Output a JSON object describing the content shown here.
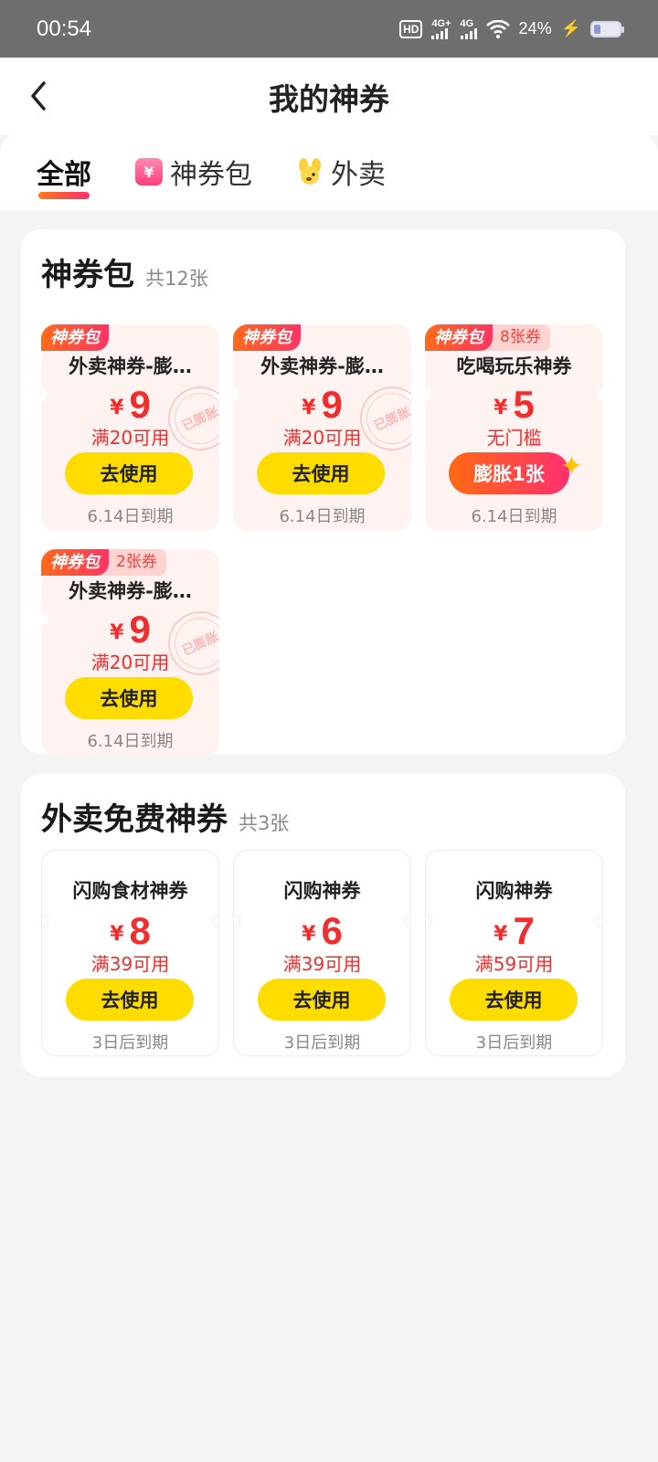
{
  "status_bar": {
    "time": "00:54",
    "hd_label": "HD",
    "net1": "4G+",
    "net2": "4G",
    "battery": "24%",
    "icons": [
      "hd-icon",
      "signal-icon",
      "signal-icon",
      "wifi-icon",
      "charging-icon",
      "battery-icon"
    ]
  },
  "header": {
    "title": "我的神券",
    "back_icon": "chevron-left-icon"
  },
  "tabs": [
    {
      "label": "全部",
      "active": true
    },
    {
      "label": "神券包",
      "icon": "coupon-pack-icon",
      "icon_text": "¥"
    },
    {
      "label": "外卖",
      "icon": "dog-mascot-icon"
    }
  ],
  "coupon_pack": {
    "title": "神券包",
    "count": "共12张",
    "coupons": [
      {
        "tag": "神券包",
        "badge": "",
        "name": "外卖神券-膨…",
        "currency": "¥",
        "amount": "9",
        "condition": "满20可用",
        "button": "去使用",
        "expiry": "6.14日到期",
        "stamp": "已膨胀"
      },
      {
        "tag": "神券包",
        "badge": "",
        "name": "外卖神券-膨…",
        "currency": "¥",
        "amount": "9",
        "condition": "满20可用",
        "button": "去使用",
        "expiry": "6.14日到期",
        "stamp": "已膨胀"
      },
      {
        "tag": "神券包",
        "badge": "8张券",
        "name": "吃喝玩乐神券",
        "currency": "¥",
        "amount": "5",
        "condition": "无门槛",
        "button": "膨胀1张",
        "expiry": "6.14日到期",
        "stamp": ""
      },
      {
        "tag": "神券包",
        "badge": "2张券",
        "name": "外卖神券-膨…",
        "currency": "¥",
        "amount": "9",
        "condition": "满20可用",
        "button": "去使用",
        "expiry": "6.14日到期",
        "stamp": "已膨胀"
      }
    ]
  },
  "free_coupons": {
    "title": "外卖免费神券",
    "count": "共3张",
    "coupons": [
      {
        "name": "闪购食材神券",
        "currency": "¥",
        "amount": "8",
        "condition": "满39可用",
        "button": "去使用",
        "expiry": "3日后到期"
      },
      {
        "name": "闪购神券",
        "currency": "¥",
        "amount": "6",
        "condition": "满39可用",
        "button": "去使用",
        "expiry": "3日后到期"
      },
      {
        "name": "闪购神券",
        "currency": "¥",
        "amount": "7",
        "condition": "满59可用",
        "button": "去使用",
        "expiry": "3日后到期"
      }
    ]
  },
  "colors": {
    "price_red": "#f02e2e",
    "button_yellow": "#ffdc00",
    "tag_gradient_start": "#ff6b1a",
    "tag_gradient_end": "#ff3464",
    "card_bg_pink": "#fff3f1"
  }
}
